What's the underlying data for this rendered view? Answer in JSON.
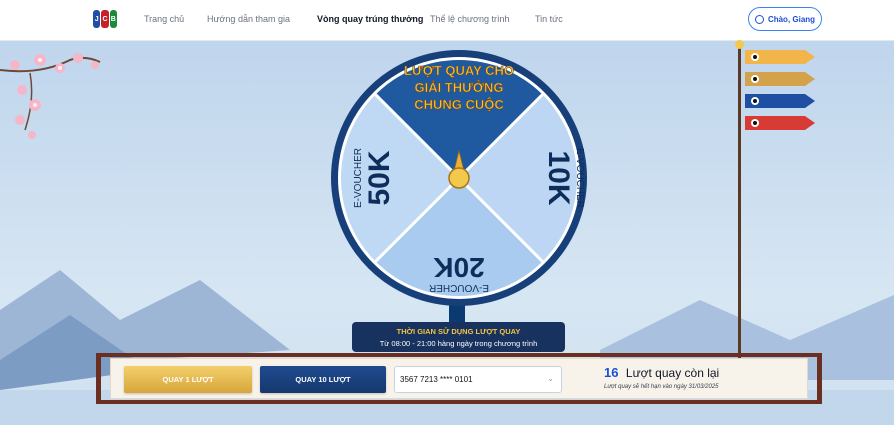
{
  "nav": {
    "logo_letters": [
      "J",
      "C",
      "B"
    ],
    "items": [
      {
        "label": "Trang chủ",
        "active": false
      },
      {
        "label": "Hướng dẫn tham gia",
        "active": false
      },
      {
        "label": "Vòng quay trúng thưởng",
        "active": true
      },
      {
        "label": "Thể lệ chương trình",
        "active": false
      },
      {
        "label": "Tin tức",
        "active": false
      }
    ],
    "greeting": "Chào, Giang"
  },
  "wheel": {
    "top_segment": [
      "LƯỢT QUAY CHO",
      "GIẢI THƯỞNG",
      "CHUNG CUỘC"
    ],
    "right_segment": {
      "label": "E-VOUCHER",
      "amount": "10K"
    },
    "left_segment": {
      "label": "E-VOUCHER",
      "amount": "50K"
    },
    "bottom_segment": {
      "label": "E-VOUCHER",
      "amount": "20K"
    }
  },
  "time_info": {
    "title": "THỜI GIAN SỬ DỤNG LƯỢT QUAY",
    "subtitle": "Từ 08:00 - 21:00 hàng ngày trong chương trình"
  },
  "controls": {
    "spin_one_label": "QUAY 1 LƯỢT",
    "spin_ten_label": "QUAY 10 LƯỢT",
    "card_number": "3567 7213 **** 0101"
  },
  "remaining": {
    "count": "16",
    "label": "Lượt quay còn lại",
    "note": "Lượt quay sẽ hết hạn vào ngày 31/03/2025"
  },
  "colors": {
    "accent_blue": "#1d4ed8",
    "wheel_navy": "#0d2e5b",
    "wheel_light": "#a9cbef",
    "gold": "#f5c542"
  }
}
